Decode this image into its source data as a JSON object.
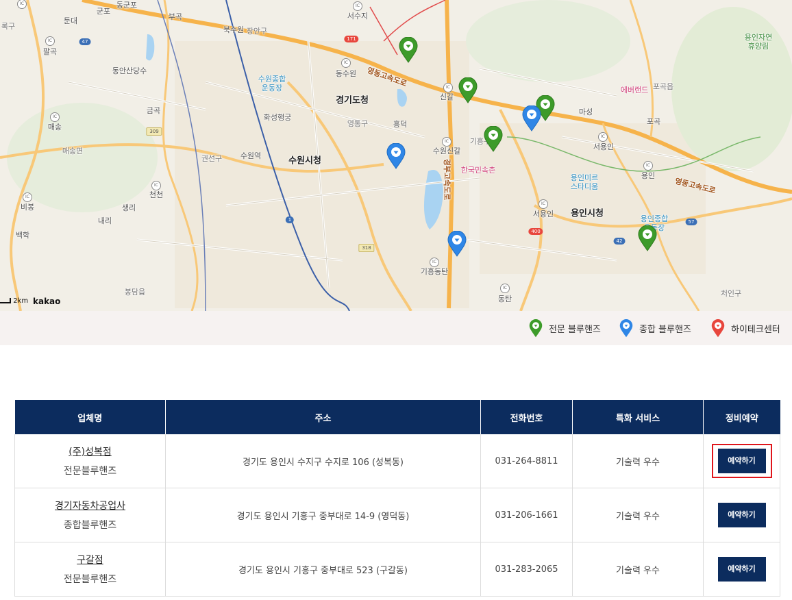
{
  "map": {
    "labels": {
      "suwon_city_hall": "수원시청",
      "gyeonggi_provincial_office": "경기도청",
      "yongin_city_hall": "용인시청",
      "suwon_station": "수원역",
      "hwaseong_haenggung": "화성행궁",
      "suwon_stadium": "수원종합\n운동장",
      "yongin_stadium": "용인종합\n운동장",
      "yongin_mireu": "용인미르\n스타디움",
      "korean_folk_village": "한국민속촌",
      "everland": "에버랜드",
      "yongin_forest": "용인자연\n휴양림",
      "expressway_1": "영동고속도로",
      "expressway_2": "영동고속도로",
      "expressway_3": "경부고속도로",
      "jangan": "장안구",
      "paldal": "영통구",
      "giheung": "기흥구",
      "gwonseon": "권선구",
      "cheoin": "처인구",
      "pogok": "포곡읍",
      "maesong": "매송면",
      "bongdam": "봉담읍",
      "pyeongtaek_gu": "록구",
      "dongsuwon": "동수원",
      "seosuwon": "서수지",
      "buksuwon": "북수원",
      "dongtan": "동탄",
      "giheung_dongtan": "기흥동탄",
      "suwon_singal": "수원신갈",
      "singal": "신갈",
      "yongin": "용인",
      "seoyongin": "서용인",
      "masung": "마성",
      "pogok_ic": "포곡",
      "bibong": "비봉",
      "naeri": "내리",
      "cheoncheon": "천천",
      "saengni": "생리",
      "geumgok": "금곡",
      "maesong_ic": "매송",
      "dongan_sandang": "동안산당수",
      "palgok": "팔곡",
      "dundae": "둔대",
      "gunpo": "군포",
      "dongunpo": "동군포",
      "bugok": "부곡",
      "baekhak": "백학",
      "yeongdeok": "흥덕",
      "route_47": "47",
      "route_171": "171",
      "route_309": "309",
      "route_318": "318",
      "route_1": "1",
      "route_42": "42",
      "route_57": "57",
      "route_400": "400"
    },
    "scale": "2km",
    "logo": "kakao"
  },
  "legend": {
    "items": [
      {
        "label": "전문 블루핸즈",
        "color": "#3d9b2a"
      },
      {
        "label": "종합 블루핸즈",
        "color": "#2f86e6"
      },
      {
        "label": "하이테크센터",
        "color": "#e8463d"
      }
    ]
  },
  "table": {
    "headers": [
      "업체명",
      "주소",
      "전화번호",
      "특화 서비스",
      "정비예약"
    ],
    "rows": [
      {
        "name": "(주)성복점",
        "type": "전문블루핸즈",
        "address": "경기도 용인시 수지구 수지로 106 (성복동)",
        "phone": "031-264-8811",
        "service": "기술력 우수",
        "button": "예약하기",
        "highlighted": true
      },
      {
        "name": "경기자동차공업사",
        "type": "종합블루핸즈",
        "address": "경기도 용인시 기흥구 중부대로 14-9 (영덕동)",
        "phone": "031-206-1661",
        "service": "기술력 우수",
        "button": "예약하기",
        "highlighted": false
      },
      {
        "name": "구갈점",
        "type": "전문블루핸즈",
        "address": "경기도 용인시 기흥구 중부대로 523 (구갈동)",
        "phone": "031-283-2065",
        "service": "기술력 우수",
        "button": "예약하기",
        "highlighted": false
      }
    ]
  }
}
